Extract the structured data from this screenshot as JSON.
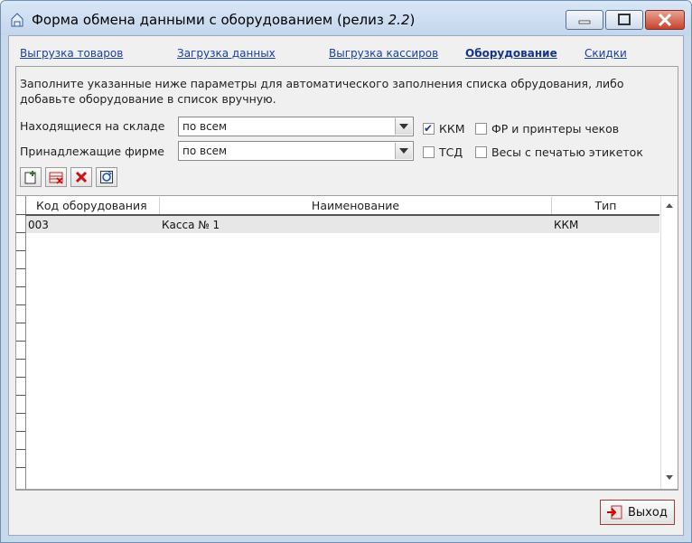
{
  "window": {
    "title_main": "Форма обмена данными с оборудованием (релиз ",
    "title_version": "2.2",
    "title_close_paren": ")"
  },
  "tabs": [
    {
      "label": "Выгрузка товаров"
    },
    {
      "label": "Загрузка данных"
    },
    {
      "label": "Выгрузка кассиров"
    },
    {
      "label": "Оборудование",
      "active": true
    },
    {
      "label": "Скидки"
    }
  ],
  "description": "Заполните указанные ниже параметры для автоматического заполнения списка обрудования, либо добавьте оборудование в список вручную.",
  "filters": {
    "warehouse_label": "Находящиеся на складе",
    "warehouse_value": "по всем",
    "company_label": "Принадлежащие фирме",
    "company_value": "по всем"
  },
  "checkboxes": [
    {
      "label": "ККМ",
      "checked": true
    },
    {
      "label": "ФР и принтеры чеков",
      "checked": false
    },
    {
      "label": "ТСД",
      "checked": false
    },
    {
      "label": "Весы с печатью этикеток",
      "checked": false
    }
  ],
  "toolbar": [
    "add-icon",
    "delete-row-icon",
    "delete-icon",
    "refresh-icon"
  ],
  "table": {
    "columns": [
      "Код оборудования",
      "Наименование",
      "Тип"
    ],
    "rows": [
      {
        "code": "003",
        "name": "Касса № 1",
        "type": "ККМ"
      }
    ]
  },
  "exit_button": {
    "label": "Выход"
  },
  "colors": {
    "titlebar": "#c9d9ec",
    "link": "#1a3fa0",
    "selected_row": "#e7e7e7",
    "close_button": "#c7432d"
  }
}
